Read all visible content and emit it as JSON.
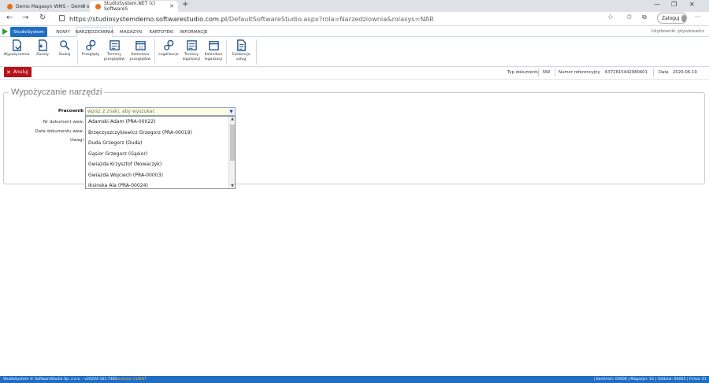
{
  "browser": {
    "tabs": [
      {
        "title": "Demo Magasyn WMS – Demo o"
      },
      {
        "title": "StudioSystem.NET (c) SoftwareS"
      }
    ],
    "url_host": "https://studiosystemdemo.softwarestudio.com.pl",
    "url_path": "/DefaultSoftwareStudio.aspx?rola=Narzedziownia&rolasys=NAR",
    "login_label": "Zaloguj"
  },
  "ribbon_tabs": [
    "StudioSystem",
    "NOWY",
    "NARZĘDZIOWNIA",
    "MAGAZYN",
    "KARTOTEKI",
    "INFORMACJE"
  ],
  "user_label": "Użytkownik: ptyszkiewicz",
  "ribbon_buttons": [
    {
      "label": "Wypożyczenia",
      "icon": "document-arrow-icon"
    },
    {
      "label": "Zwroty",
      "icon": "document-return-icon"
    },
    {
      "label": "Szukaj",
      "icon": "search-tool-icon"
    },
    {
      "label": "Przeglądy",
      "icon": "gears-icon"
    },
    {
      "label": "Terminy przeglądów",
      "icon": "calendar-list-icon"
    },
    {
      "label": "Kalendarz przeglądów",
      "icon": "calendar-icon"
    },
    {
      "label": "Legalizacje",
      "icon": "gears-icon"
    },
    {
      "label": "Terminy legalizacji",
      "icon": "calendar-list-icon"
    },
    {
      "label": "Kalendarz legalizacji",
      "icon": "calendar-icon"
    },
    {
      "label": "Ewidencja usług",
      "icon": "document-list-icon"
    }
  ],
  "toolbar": {
    "cancel_label": "Anuluj",
    "doc_type_label": "Typ dokumentu",
    "doc_type_value": "NW",
    "ref_label": "Numer referencyjny",
    "ref_value": "637281544298040​1",
    "date_label": "Data",
    "date_value": "2020-06-19"
  },
  "form": {
    "legend": "Wypożyczanie narzędzi",
    "employee_label": "Pracownik",
    "employee_placeholder": "wpisz 2 znaki, aby wyszukać",
    "docnum_label": "Nr dokument wew.",
    "docdate_label": "Data dokumentu wew.",
    "notes_label": "Uwagi"
  },
  "dropdown_items": [
    "Adamski Adam (PRA-00022)",
    "Brzęczyszczykiewicz Grzegorz (PRA-00019)",
    "Duda Grzegorz (Duda)",
    "Gąsior Grzegorz (Gąsior)",
    "Gwiazda Krzysztof (Nowaczyk)",
    "Gwiazda Wojciech (PRA-00003)",
    "Iksinska Ala (PRA-00024)"
  ],
  "status": {
    "left": "StudioSystem © SoftwareStudio Sp. z o.o. - v20204.161.7465",
    "client": "Licencja: CLIENT",
    "right": "| Kamiński: 00008 | Magazyn: 01 | Oddział: 00005 | Firma: 01"
  }
}
